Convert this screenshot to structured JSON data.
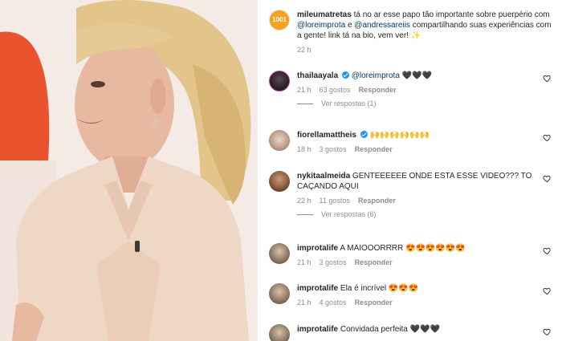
{
  "caption": {
    "username": "mileumatretas",
    "text_1": " tá no ar esse papo tão importante sobre puerpério com ",
    "mention_1": "@loreimprota",
    "text_2": " e ",
    "mention_2": "@andressareiis",
    "text_3": " compartilhando suas experiências com a gente! link tá na bio, vem ver! ✨",
    "time": "22 h",
    "logo_text": "1001"
  },
  "comments": [
    {
      "username": "thailaayala",
      "verified": true,
      "mention": "@loreimprota",
      "text": " 🖤🖤🖤",
      "time": "21 h",
      "likes": "63 gostos",
      "reply": "Responder",
      "view_replies": "Ver respostas (1)"
    },
    {
      "username": "fiorellamattheis",
      "verified": true,
      "text": " 🙌🙌🙌🙌🙌🙌",
      "time": "18 h",
      "likes": "3 gostos",
      "reply": "Responder"
    },
    {
      "username": "nykitaalmeida",
      "text": " GENTEEEEEE ONDE ESTA ESSE VIDEO??? TO CAÇANDO AQUI",
      "time": "22 h",
      "likes": "11 gostos",
      "reply": "Responder",
      "view_replies": "Ver respostas (6)"
    },
    {
      "username": "improtalife",
      "text": " A MAIOOORRRR 😍😍😍😍😍😍",
      "time": "21 h",
      "likes": "3 gostos",
      "reply": "Responder"
    },
    {
      "username": "improtalife",
      "text": " Ela é incrível 😍😍😍",
      "time": "21 h",
      "likes": "4 gostos",
      "reply": "Responder"
    },
    {
      "username": "improtalife",
      "text": " Convidada perfeita 🖤🖤🖤",
      "time": "",
      "likes": "",
      "reply": ""
    }
  ],
  "icons": {
    "like": "heart-icon",
    "verified": "verified-badge-icon"
  },
  "colors": {
    "link": "#00376b",
    "muted": "#8e8e8e",
    "verified": "#1e90ff"
  }
}
